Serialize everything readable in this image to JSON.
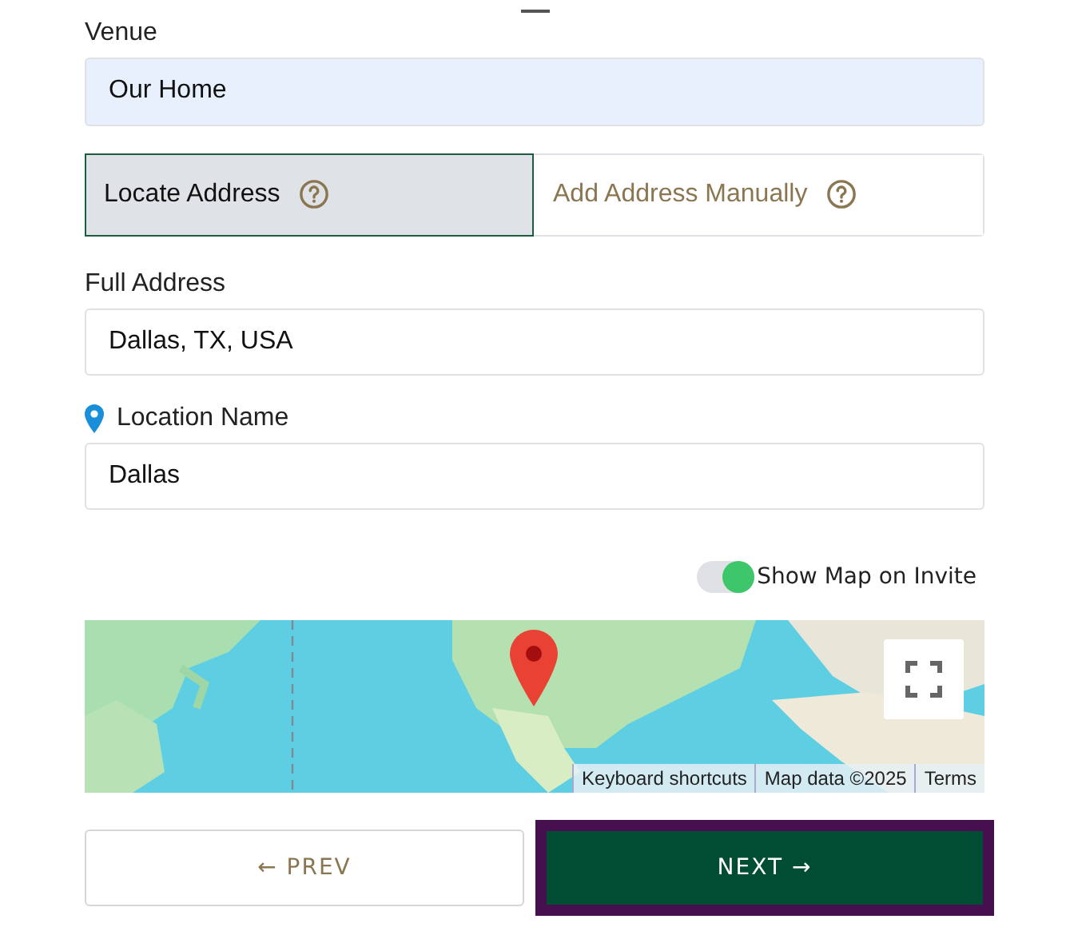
{
  "venue": {
    "label": "Venue",
    "value": "Our Home"
  },
  "address_tabs": [
    {
      "label": "Locate Address",
      "selected": true
    },
    {
      "label": "Add Address Manually",
      "selected": false
    }
  ],
  "full_address": {
    "label": "Full Address",
    "value": "Dallas, TX, USA"
  },
  "location_name": {
    "label": "Location Name",
    "value": "Dallas"
  },
  "show_map": {
    "label": "Show Map on Invite",
    "on": true
  },
  "map": {
    "kind": "picture",
    "attribution": [
      "Keyboard shortcuts",
      "Map data ©2025",
      "Terms"
    ]
  },
  "buttons": [
    {
      "label": "← PREV",
      "kind": "secondary"
    },
    {
      "label": "NEXT →",
      "kind": "primary"
    }
  ]
}
